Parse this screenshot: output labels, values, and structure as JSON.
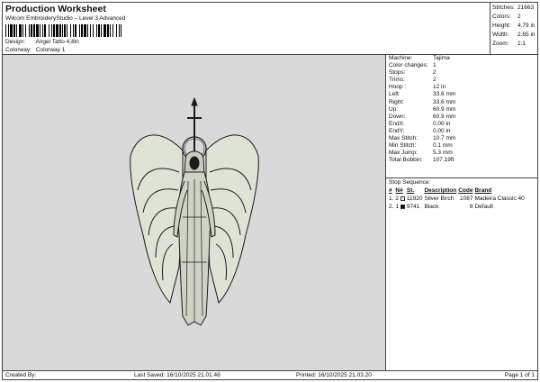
{
  "header": {
    "title": "Production Worksheet",
    "subtitle": "Wilcom EmbroideryStudio – Level 3 Advanced",
    "barcode_label": "1"
  },
  "design": {
    "design_label": "Design:",
    "design_value": "Angel Tatto 4,8in",
    "colorway_label": "Colorway:",
    "colorway_value": "Colorway 1"
  },
  "stats": [
    {
      "label": "Stitches:",
      "value": "21663"
    },
    {
      "label": "Colors:",
      "value": "2"
    },
    {
      "label": "Height:",
      "value": "4.79 in"
    },
    {
      "label": "Width:",
      "value": "2.65 in"
    },
    {
      "label": "Zoom:",
      "value": "1:1"
    }
  ],
  "machine_info": [
    {
      "label": "Machine:",
      "value": "Tajima"
    },
    {
      "label": "Color changes:",
      "value": "1"
    },
    {
      "label": "Stops:",
      "value": "2"
    },
    {
      "label": "Trims:",
      "value": "2"
    },
    {
      "label": "Hoop :",
      "value": "12 in"
    },
    {
      "label": "Left:",
      "value": "33.6 mm"
    },
    {
      "label": "Right:",
      "value": "33.6 mm"
    },
    {
      "label": "Up:",
      "value": "60.9 mm"
    },
    {
      "label": "Down:",
      "value": "60.9 mm"
    },
    {
      "label": "EndX:",
      "value": "0.00 in"
    },
    {
      "label": "EndY:",
      "value": "0.00 in"
    },
    {
      "label": "Max Stitch:",
      "value": "10.7 mm"
    },
    {
      "label": "Min Stitch:",
      "value": "0.1 mm"
    },
    {
      "label": "Max Jump:",
      "value": "5.3 mm"
    },
    {
      "label": "Total Bobbin:",
      "value": "107.19ft"
    }
  ],
  "stop_sequence": {
    "title": "Stop Sequence:",
    "headers": [
      "#",
      "N#",
      "St.",
      "Description",
      "Code",
      "Brand"
    ],
    "rows": [
      {
        "num": "1.",
        "n": "2",
        "color": "#ffffff",
        "st": "11920",
        "description": "Silver Birch",
        "code": "1087",
        "brand": "Madeira Classic 40"
      },
      {
        "num": "2.",
        "n": "1",
        "color": "#000000",
        "st": "9741",
        "description": "Black",
        "code": "8",
        "brand": "Default"
      }
    ]
  },
  "footer": {
    "created_by": "Created By:",
    "last_saved": "Last Saved: 16/10/2025 21.01.48",
    "printed": "Printed: 16/10/2025 21.03.20",
    "page": "Page 1 of 1"
  },
  "colors": {
    "design_background": "#d9d9d9",
    "thread_light": "#dfe3d6",
    "thread_dark": "#1a1a1a"
  }
}
